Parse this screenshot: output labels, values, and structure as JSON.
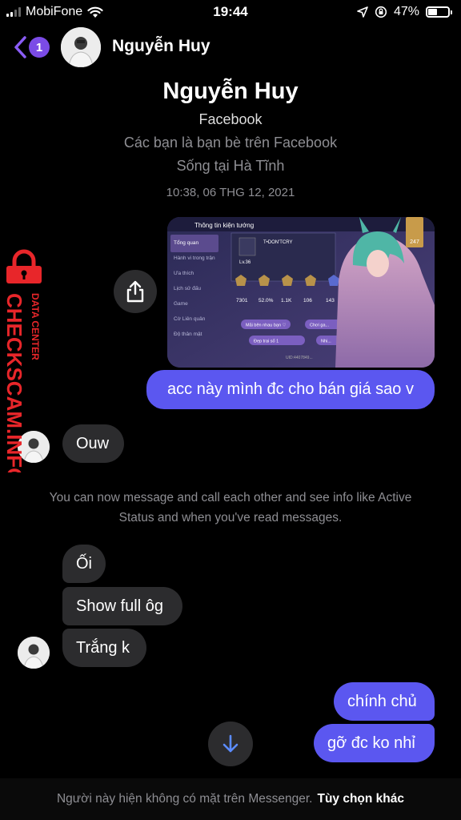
{
  "status_bar": {
    "carrier": "MobiFone",
    "time": "19:44",
    "battery": "47%",
    "battery_level": 0.47
  },
  "nav": {
    "back_badge": "1",
    "contact_name": "Nguyễn Huy"
  },
  "profile": {
    "name": "Nguyễn Huy",
    "platform": "Facebook",
    "friends_note": "Các bạn là bạn bè trên Facebook",
    "location": "Sống tại Hà Tĩnh"
  },
  "timestamp": "10:38, 06 THG 12, 2021",
  "game_screenshot": {
    "header": "Thông tin kiện tướng",
    "menu": [
      "Tổng quan",
      "Hành vi trong trận",
      "Ưa thích",
      "Lịch sử đấu",
      "Game",
      "Cờ Liên quân",
      "Độ thân mật"
    ],
    "player_name": "T•DON'TCRY",
    "level": "Lv.36",
    "stats": [
      "7301",
      "52.0%",
      "1.1K",
      "106",
      "143"
    ],
    "tags": [
      "Mãi bên nhau bạn ♡",
      "Chơi ga...",
      "Đẹp trai số 1",
      "Nhi..."
    ],
    "uid": "UID:4407849...",
    "rank": "247"
  },
  "messages": [
    {
      "id": "m1",
      "side": "out",
      "text": "acc này mình đc cho bán giá sao v"
    },
    {
      "id": "m2",
      "side": "in",
      "text": "Ouw"
    },
    {
      "id": "m3",
      "side": "in",
      "text": "Ối"
    },
    {
      "id": "m4",
      "side": "in",
      "text": "Show full ôg"
    },
    {
      "id": "m5",
      "side": "in",
      "text": "Trắng k"
    },
    {
      "id": "m6",
      "side": "out",
      "text": "chính chủ"
    },
    {
      "id": "m7",
      "side": "out",
      "text": "gỡ đc ko nhỉ"
    }
  ],
  "system_note": "You can now message and call each other and see info like Active Status and when you've read messages.",
  "bottom_bar": {
    "note": "Người này hiện không có mặt trên Messenger.",
    "action": "Tùy chọn khác"
  },
  "watermark": {
    "line1": "DATA CENTER",
    "line2": "CHECKSCAM.INFO"
  },
  "colors": {
    "outgoing_bubble": "#5b57f0",
    "incoming_bubble": "#2c2c2e",
    "accent": "#7b4be6",
    "watermark": "#e8262a"
  }
}
